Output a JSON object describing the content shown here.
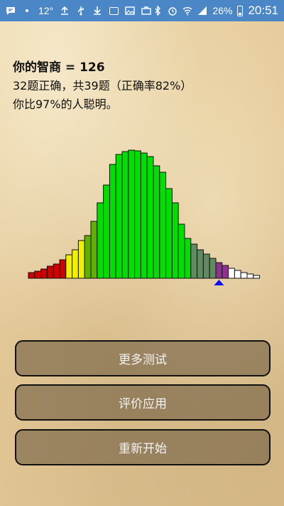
{
  "status_bar": {
    "temperature": "12°",
    "battery_percent": "26%",
    "time": "20:51"
  },
  "result": {
    "iq_line": "你的智商 = 126",
    "score_line": "32题正确，共39题（正确率82%）",
    "percentile_line": "你比97%的人聪明。"
  },
  "chart_data": {
    "type": "bar",
    "values": [
      8,
      10,
      13,
      17,
      20,
      26,
      33,
      40,
      53,
      60,
      80,
      106,
      131,
      160,
      174,
      178,
      180,
      179,
      176,
      171,
      158,
      149,
      126,
      106,
      76,
      56,
      48,
      40,
      34,
      28,
      22,
      18,
      14,
      11,
      8,
      6,
      4
    ],
    "colors": [
      "#d00000",
      "#d00000",
      "#d00000",
      "#d00000",
      "#d00000",
      "#d00000",
      "#f0f000",
      "#f0f000",
      "#f0f000",
      "#60b000",
      "#60b000",
      "#00e000",
      "#00e000",
      "#00e000",
      "#00e000",
      "#00e000",
      "#00e000",
      "#00e000",
      "#00e000",
      "#00e000",
      "#00e000",
      "#00e000",
      "#00e000",
      "#00e000",
      "#00e000",
      "#00e000",
      "#608a60",
      "#608a60",
      "#608a60",
      "#608a60",
      "#903090",
      "#903090",
      "#ffffff",
      "#ffffff",
      "#ffffff",
      "#ffffff",
      "#ffffff"
    ],
    "marker_index": 30,
    "marker_color": "#0a0aff",
    "ylim": [
      0,
      180
    ]
  },
  "buttons": {
    "more_tests": "更多测试",
    "rate_app": "评价应用",
    "restart": "重新开始"
  }
}
